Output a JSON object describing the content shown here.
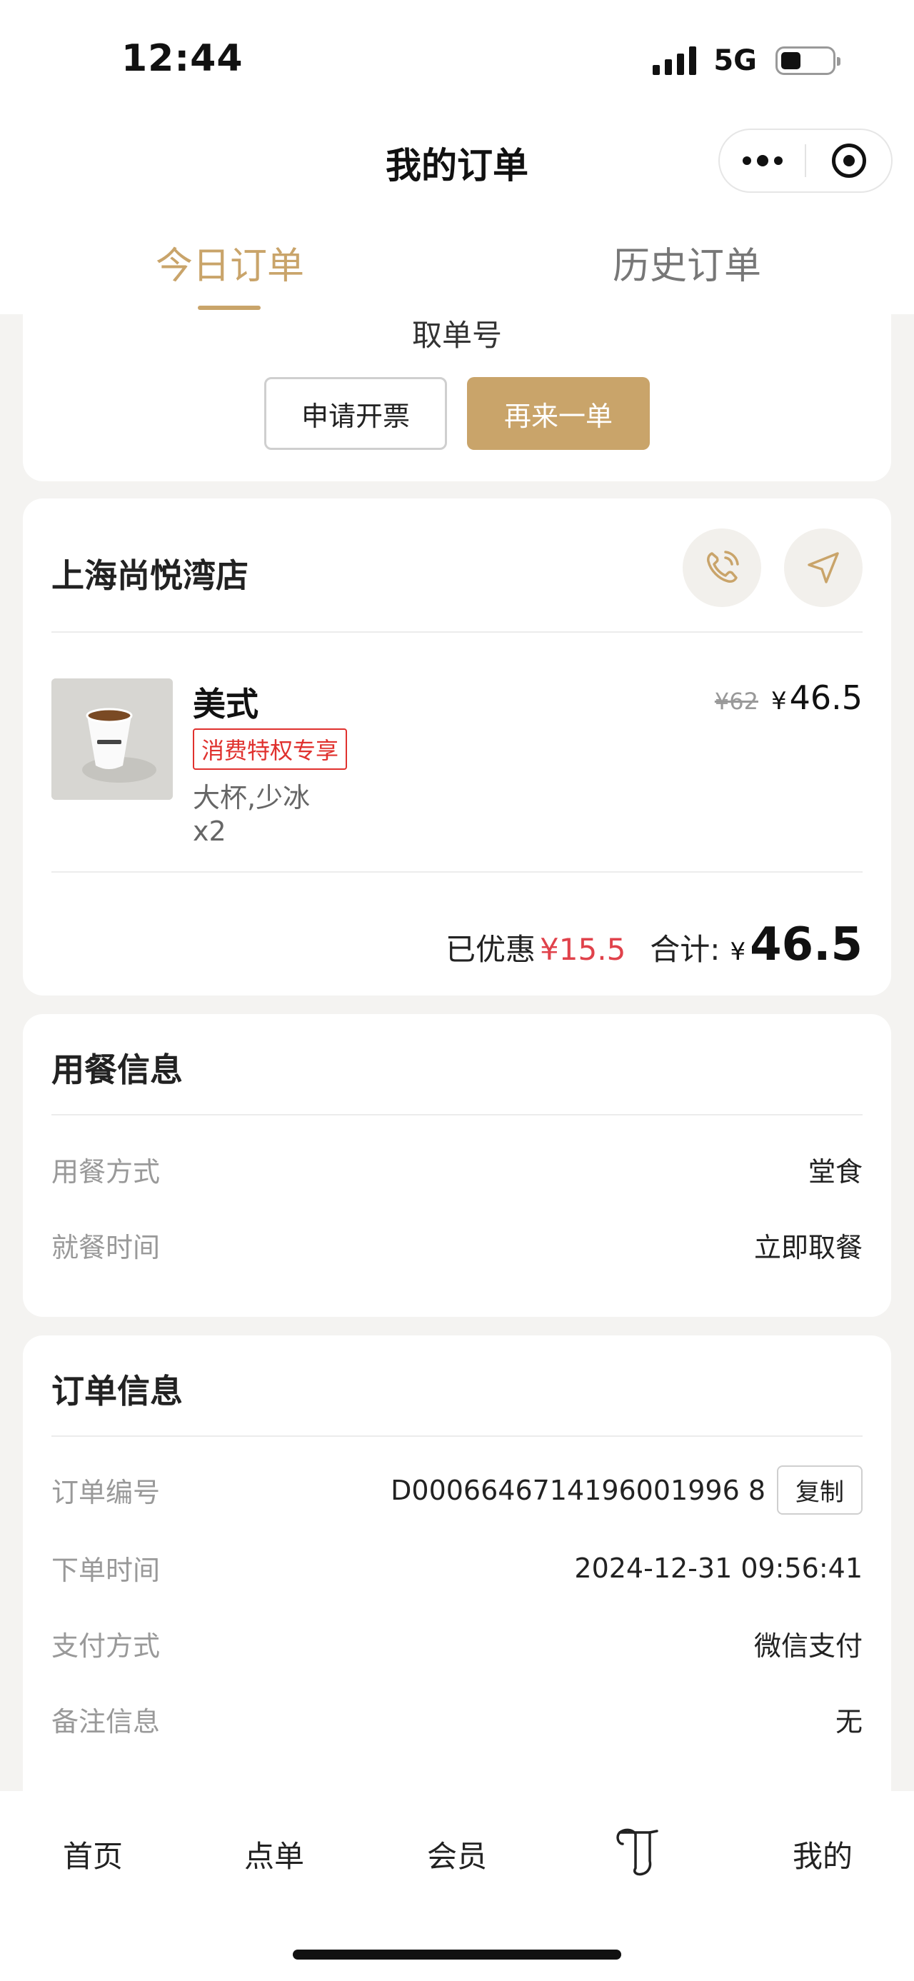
{
  "status_bar": {
    "time": "12:44",
    "network": "5G"
  },
  "nav": {
    "title": "我的订单"
  },
  "tabs": {
    "today": "今日订单",
    "history": "历史订单",
    "active": "today"
  },
  "pickup_card": {
    "label": "取单号",
    "invoice_button": "申请开票",
    "reorder_button": "再来一单"
  },
  "store": {
    "name": "上海尚悦湾店",
    "phone_icon": "phone-icon",
    "navigate_icon": "navigate-icon"
  },
  "product": {
    "name": "美式",
    "tag": "消费特权专享",
    "spec": "大杯,少冰",
    "qty": "x2",
    "original_price": "¥62",
    "currency": "¥",
    "price": "46.5"
  },
  "totals": {
    "discount_label": "已优惠",
    "discount_value": "¥15.5",
    "sum_label": "合计:",
    "currency": "¥",
    "sum_value": "46.5"
  },
  "dining_info": {
    "title": "用餐信息",
    "rows": [
      {
        "label": "用餐方式",
        "value": "堂食"
      },
      {
        "label": "就餐时间",
        "value": "立即取餐"
      }
    ]
  },
  "order_info": {
    "title": "订单信息",
    "order_no_label": "订单编号",
    "order_no_value": "D0006646714196001996 8",
    "copy_button": "复制",
    "rows": [
      {
        "label": "下单时间",
        "value": "2024-12-31 09:56:41"
      },
      {
        "label": "支付方式",
        "value": "微信支付"
      },
      {
        "label": "备注信息",
        "value": "无"
      }
    ]
  },
  "tab_bar": {
    "items": [
      "首页",
      "点单",
      "会员",
      "",
      "我的"
    ]
  },
  "colors": {
    "accent": "#c9a46a",
    "discount": "#e0424b",
    "tag_red": "#e0312e"
  }
}
